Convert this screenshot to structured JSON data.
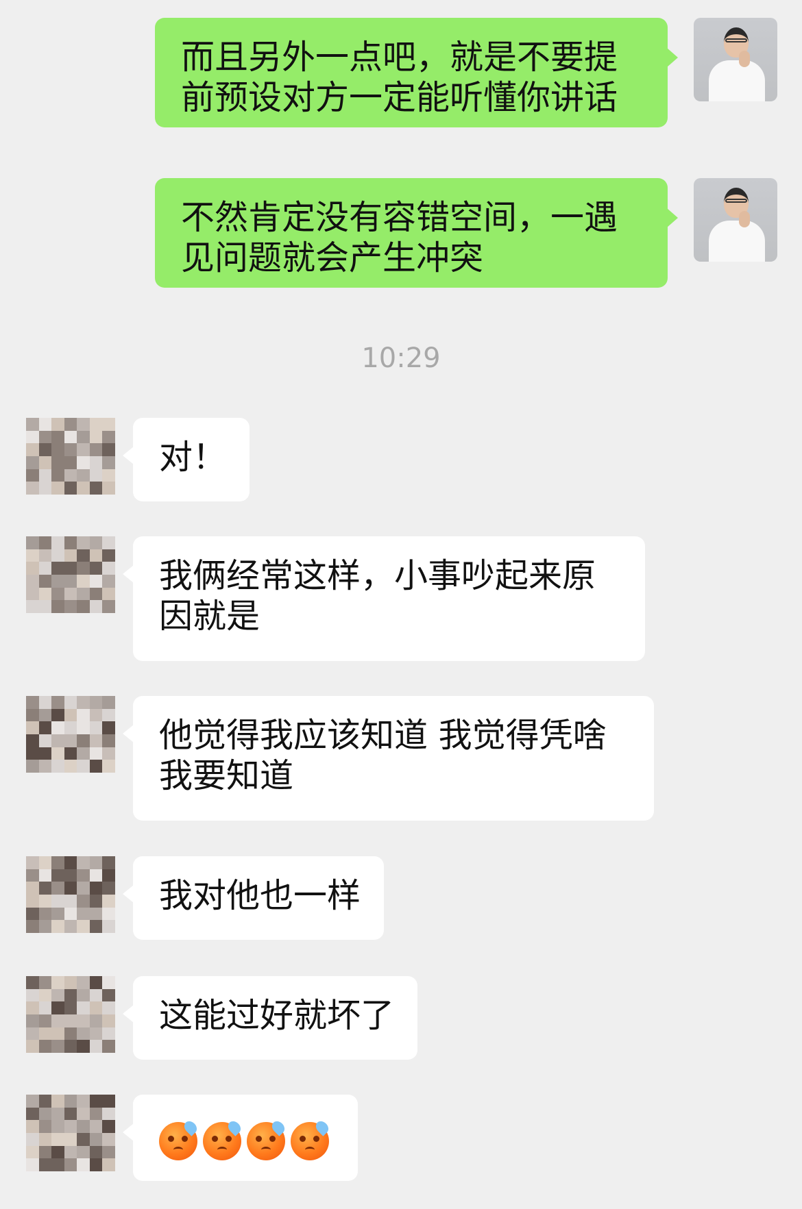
{
  "messages_out": [
    {
      "id": "out1",
      "text": "而且另外一点吧，就是不要提前预设对方一定能听懂你讲话"
    },
    {
      "id": "out2",
      "text": "不然肯定没有容错空间，一遇见问题就会产生冲突"
    }
  ],
  "timestamp": "10:29",
  "messages_in": [
    {
      "id": "in1",
      "text": "对！"
    },
    {
      "id": "in2",
      "text": "我俩经常这样，小事吵起来原因就是"
    },
    {
      "id": "in3",
      "text": "他觉得我应该知道 我觉得凭啥我要知道"
    },
    {
      "id": "in4",
      "text": "我对他也一样"
    },
    {
      "id": "in5",
      "text": "这能过好就坏了"
    },
    {
      "id": "in6",
      "emoji": "sweat-frown-emoji",
      "emoji_count": 4
    }
  ],
  "colors": {
    "background": "#efefef",
    "outgoing_bubble": "#95ec69",
    "incoming_bubble": "#ffffff",
    "timestamp": "#a8a8a8"
  }
}
